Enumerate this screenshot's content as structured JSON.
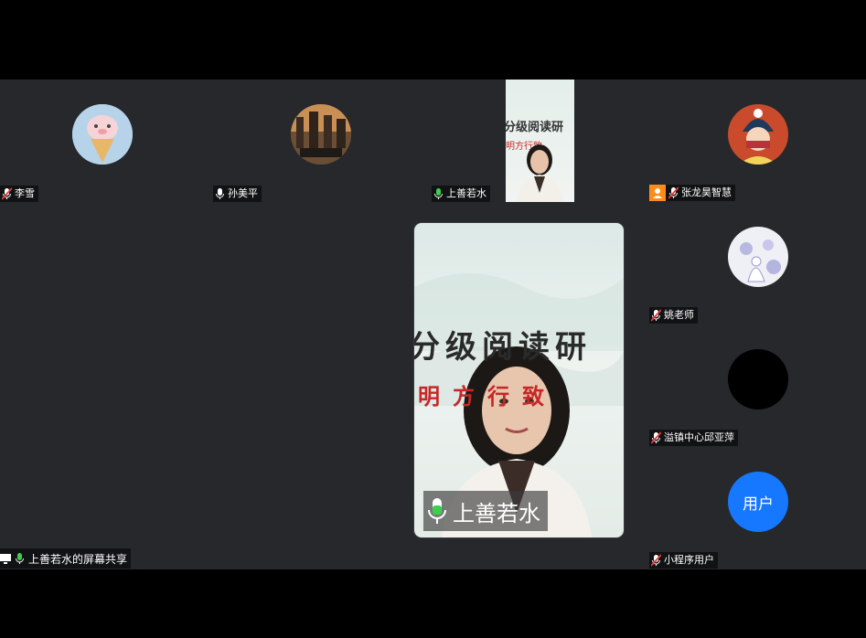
{
  "participants": [
    {
      "name": "李雪",
      "mic": "muted"
    },
    {
      "name": "孙美平",
      "mic": "on"
    },
    {
      "name": "上善若水",
      "mic": "speaking"
    },
    {
      "name": "张龙昊智慧",
      "mic": "muted",
      "badge": "host-icon"
    },
    {
      "name": "姚老师",
      "mic": "muted"
    },
    {
      "name": "溢镇中心邱亚萍",
      "mic": "muted"
    },
    {
      "name": "小程序用户",
      "mic": "muted",
      "avatar_text": "用户"
    }
  ],
  "main_speaker": {
    "name": "上善若水",
    "mic": "speaking"
  },
  "screen_share": {
    "label": "上善若水的屏幕共享"
  },
  "banner_text": {
    "line1": "分级阅读研",
    "line2": "明方行致"
  },
  "colors": {
    "background": "#26282b",
    "speaking_mic": "#3ccf4e",
    "muted_mic": "#e23b3b",
    "avatar_blue": "#1677ff",
    "host_badge": "#ff8c1a"
  }
}
